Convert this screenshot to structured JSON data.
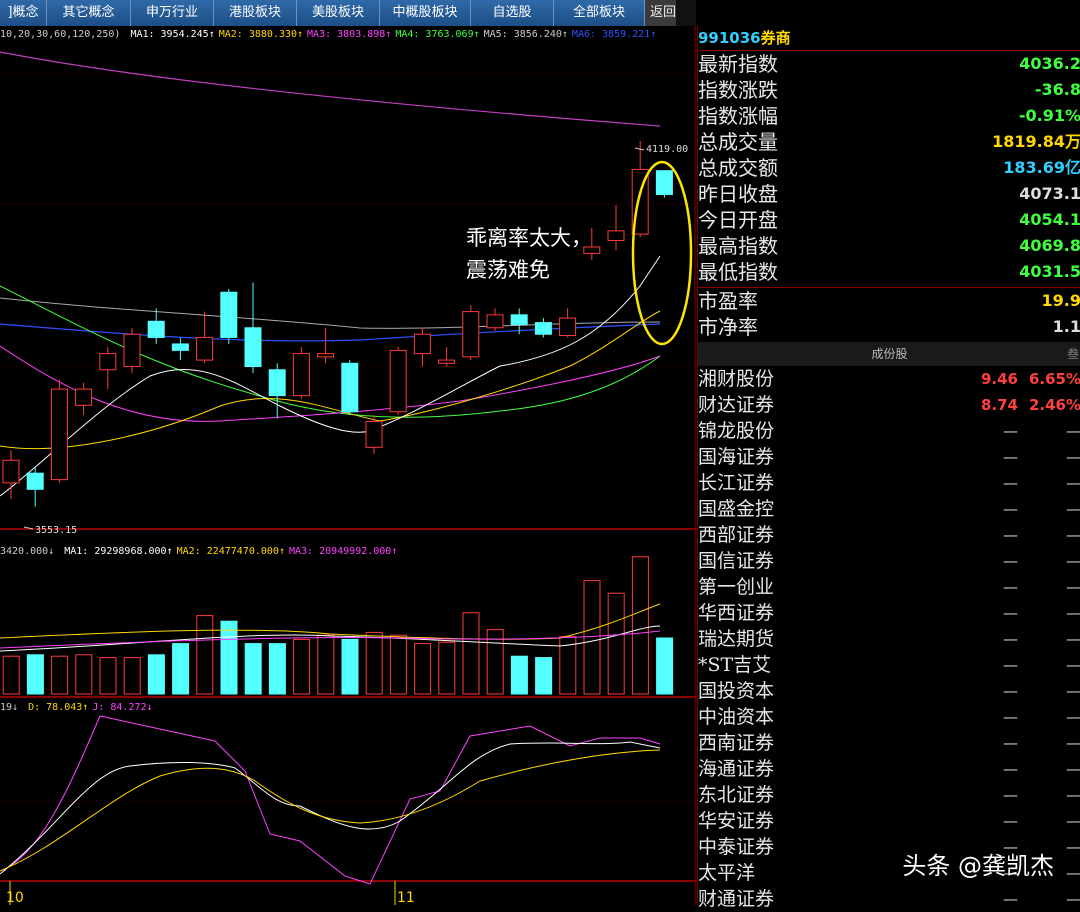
{
  "tabs": [
    {
      "label": "行业概念",
      "partial": "]概念"
    },
    {
      "label": "其它概念"
    },
    {
      "label": "申万行业"
    },
    {
      "label": "港股板块"
    },
    {
      "label": "美股板块"
    },
    {
      "label": "中概股板块"
    },
    {
      "label": "自选股"
    },
    {
      "label": "全部板块"
    },
    {
      "label": "返回"
    }
  ],
  "indicators": {
    "ma_line": {
      "prefix": "10,20,30,60,120,250)",
      "items": [
        {
          "label": "MA1: 3954.245↑",
          "color": "#ffffff"
        },
        {
          "label": "MA2: 3880.330↑",
          "color": "#ffd800"
        },
        {
          "label": "MA3: 3803.898↑",
          "color": "#ff40ff"
        },
        {
          "label": "MA4: 3763.069↑",
          "color": "#40ff40"
        },
        {
          "label": "MA5: 3856.240↑",
          "color": "#cccccc"
        },
        {
          "label": "MA6: 3859.221↑",
          "color": "#3050ff"
        }
      ]
    },
    "vol_line": {
      "prefix": "3420.000↓",
      "items": [
        {
          "label": "MA1: 29298968.000↑",
          "color": "#ffffff"
        },
        {
          "label": "MA2: 22477470.000↑",
          "color": "#ffd800"
        },
        {
          "label": "MA3: 20949992.000↑",
          "color": "#ff40ff"
        }
      ]
    },
    "kdj_line": {
      "prefix": "19↓",
      "items": [
        {
          "label": "D: 78.043↑",
          "color": "#ffd800"
        },
        {
          "label": "J: 84.272↓",
          "color": "#ff40ff"
        }
      ]
    }
  },
  "price_labels": {
    "high": "4119.00",
    "low": "3553.15"
  },
  "annotation": {
    "line1": "乖离率太大，",
    "line2": "震荡难免"
  },
  "date_labels": {
    "oct": "10",
    "nov": "11"
  },
  "right_panel": {
    "code": "991036",
    "name": "券商",
    "quote": [
      {
        "label": "最新指数",
        "value": "4036.2",
        "color": "#40ff40"
      },
      {
        "label": "指数涨跌",
        "value": "-36.8",
        "color": "#40ff40"
      },
      {
        "label": "指数涨幅",
        "value": "-0.91%",
        "color": "#40ff40"
      },
      {
        "label": "总成交量",
        "value": "1819.84万",
        "color": "#ffd800"
      },
      {
        "label": "总成交额",
        "value": "183.69亿",
        "color": "#2fd0ff"
      },
      {
        "label": "昨日收盘",
        "value": "4073.1",
        "color": "#dddddd"
      },
      {
        "label": "今日开盘",
        "value": "4054.1",
        "color": "#40ff40"
      },
      {
        "label": "最高指数",
        "value": "4069.8",
        "color": "#40ff40"
      },
      {
        "label": "最低指数",
        "value": "4031.5",
        "color": "#40ff40"
      }
    ],
    "valuation": [
      {
        "label": "市盈率",
        "value": "19.9",
        "color": "#ffd800"
      },
      {
        "label": "市净率",
        "value": "1.1",
        "color": "#dddddd"
      }
    ],
    "constituents_header": "成份股",
    "constituents_header_extra": "叁",
    "constituents": [
      {
        "name": "湘财股份",
        "price": "9.46",
        "change": "6.65%"
      },
      {
        "name": "财达证券",
        "price": "8.74",
        "change": "2.46%"
      },
      {
        "name": "锦龙股份",
        "price": "—",
        "change": "—"
      },
      {
        "name": "国海证券",
        "price": "—",
        "change": "—"
      },
      {
        "name": "长江证券",
        "price": "—",
        "change": "—"
      },
      {
        "name": "国盛金控",
        "price": "—",
        "change": "—"
      },
      {
        "name": "西部证券",
        "price": "—",
        "change": "—"
      },
      {
        "name": "国信证券",
        "price": "—",
        "change": "—"
      },
      {
        "name": "第一创业",
        "price": "—",
        "change": "—"
      },
      {
        "name": "华西证券",
        "price": "—",
        "change": "—"
      },
      {
        "name": "瑞达期货",
        "price": "—",
        "change": "—"
      },
      {
        "name": "*ST吉艾",
        "price": "—",
        "change": "—"
      },
      {
        "name": "国投资本",
        "price": "—",
        "change": "—"
      },
      {
        "name": "中油资本",
        "price": "—",
        "change": "—"
      },
      {
        "name": "西南证券",
        "price": "—",
        "change": "—"
      },
      {
        "name": "海通证券",
        "price": "—",
        "change": "—"
      },
      {
        "name": "东北证券",
        "price": "—",
        "change": "—"
      },
      {
        "name": "华安证券",
        "price": "—",
        "change": "—"
      },
      {
        "name": "中泰证券",
        "price": "—",
        "change": "—"
      },
      {
        "name": "太平洋",
        "price": "—",
        "change": "—"
      },
      {
        "name": "财通证券",
        "price": "—",
        "change": "—"
      }
    ]
  },
  "watermark": "头条 @龚凯杰",
  "chart_data": {
    "type": "candlestick",
    "price_range": [
      3553.15,
      4119.0
    ],
    "candles": [
      {
        "o": 3590,
        "c": 3625,
        "h": 3640,
        "l": 3565
      },
      {
        "o": 3605,
        "c": 3580,
        "h": 3615,
        "l": 3553.15
      },
      {
        "o": 3595,
        "c": 3735,
        "h": 3750,
        "l": 3590
      },
      {
        "o": 3710,
        "c": 3735,
        "h": 3745,
        "l": 3695
      },
      {
        "o": 3765,
        "c": 3790,
        "h": 3800,
        "l": 3735
      },
      {
        "o": 3770,
        "c": 3820,
        "h": 3830,
        "l": 3760
      },
      {
        "o": 3840,
        "c": 3815,
        "h": 3860,
        "l": 3805
      },
      {
        "o": 3805,
        "c": 3795,
        "h": 3815,
        "l": 3780
      },
      {
        "o": 3780,
        "c": 3815,
        "h": 3855,
        "l": 3775
      },
      {
        "o": 3885,
        "c": 3815,
        "h": 3890,
        "l": 3805
      },
      {
        "o": 3830,
        "c": 3770,
        "h": 3900,
        "l": 3760
      },
      {
        "o": 3765,
        "c": 3725,
        "h": 3775,
        "l": 3690
      },
      {
        "o": 3725,
        "c": 3790,
        "h": 3800,
        "l": 3720
      },
      {
        "o": 3785,
        "c": 3790,
        "h": 3830,
        "l": 3775
      },
      {
        "o": 3775,
        "c": 3700,
        "h": 3780,
        "l": 3695
      },
      {
        "o": 3645,
        "c": 3685,
        "h": 3695,
        "l": 3635
      },
      {
        "o": 3700,
        "c": 3795,
        "h": 3800,
        "l": 3695
      },
      {
        "o": 3790,
        "c": 3820,
        "h": 3830,
        "l": 3770
      },
      {
        "o": 3775,
        "c": 3780,
        "h": 3800,
        "l": 3770
      },
      {
        "o": 3785,
        "c": 3855,
        "h": 3865,
        "l": 3780
      },
      {
        "o": 3830,
        "c": 3850,
        "h": 3860,
        "l": 3825
      },
      {
        "o": 3850,
        "c": 3835,
        "h": 3860,
        "l": 3820
      },
      {
        "o": 3838,
        "c": 3820,
        "h": 3845,
        "l": 3815
      },
      {
        "o": 3818,
        "c": 3845,
        "h": 3860,
        "l": 3815
      },
      {
        "o": 3945,
        "c": 3955,
        "h": 3985,
        "l": 3935
      },
      {
        "o": 3965,
        "c": 3980,
        "h": 4020,
        "l": 3950
      },
      {
        "o": 3975,
        "c": 4075,
        "h": 4119.0,
        "l": 3970
      },
      {
        "o": 4073.1,
        "c": 4036.2,
        "h": 4069.8,
        "l": 4031.5
      }
    ],
    "volumes": [
      0.28,
      0.27,
      0.28,
      0.27,
      0.28,
      0.26,
      0.26,
      0.28,
      0.36,
      0.56,
      0.52,
      0.36,
      0.36,
      0.39,
      0.42,
      0.39,
      0.44,
      0.42,
      0.36,
      0.37,
      0.58,
      0.46,
      0.27,
      0.26,
      0.41,
      0.81,
      0.72,
      0.98,
      0.4
    ]
  }
}
